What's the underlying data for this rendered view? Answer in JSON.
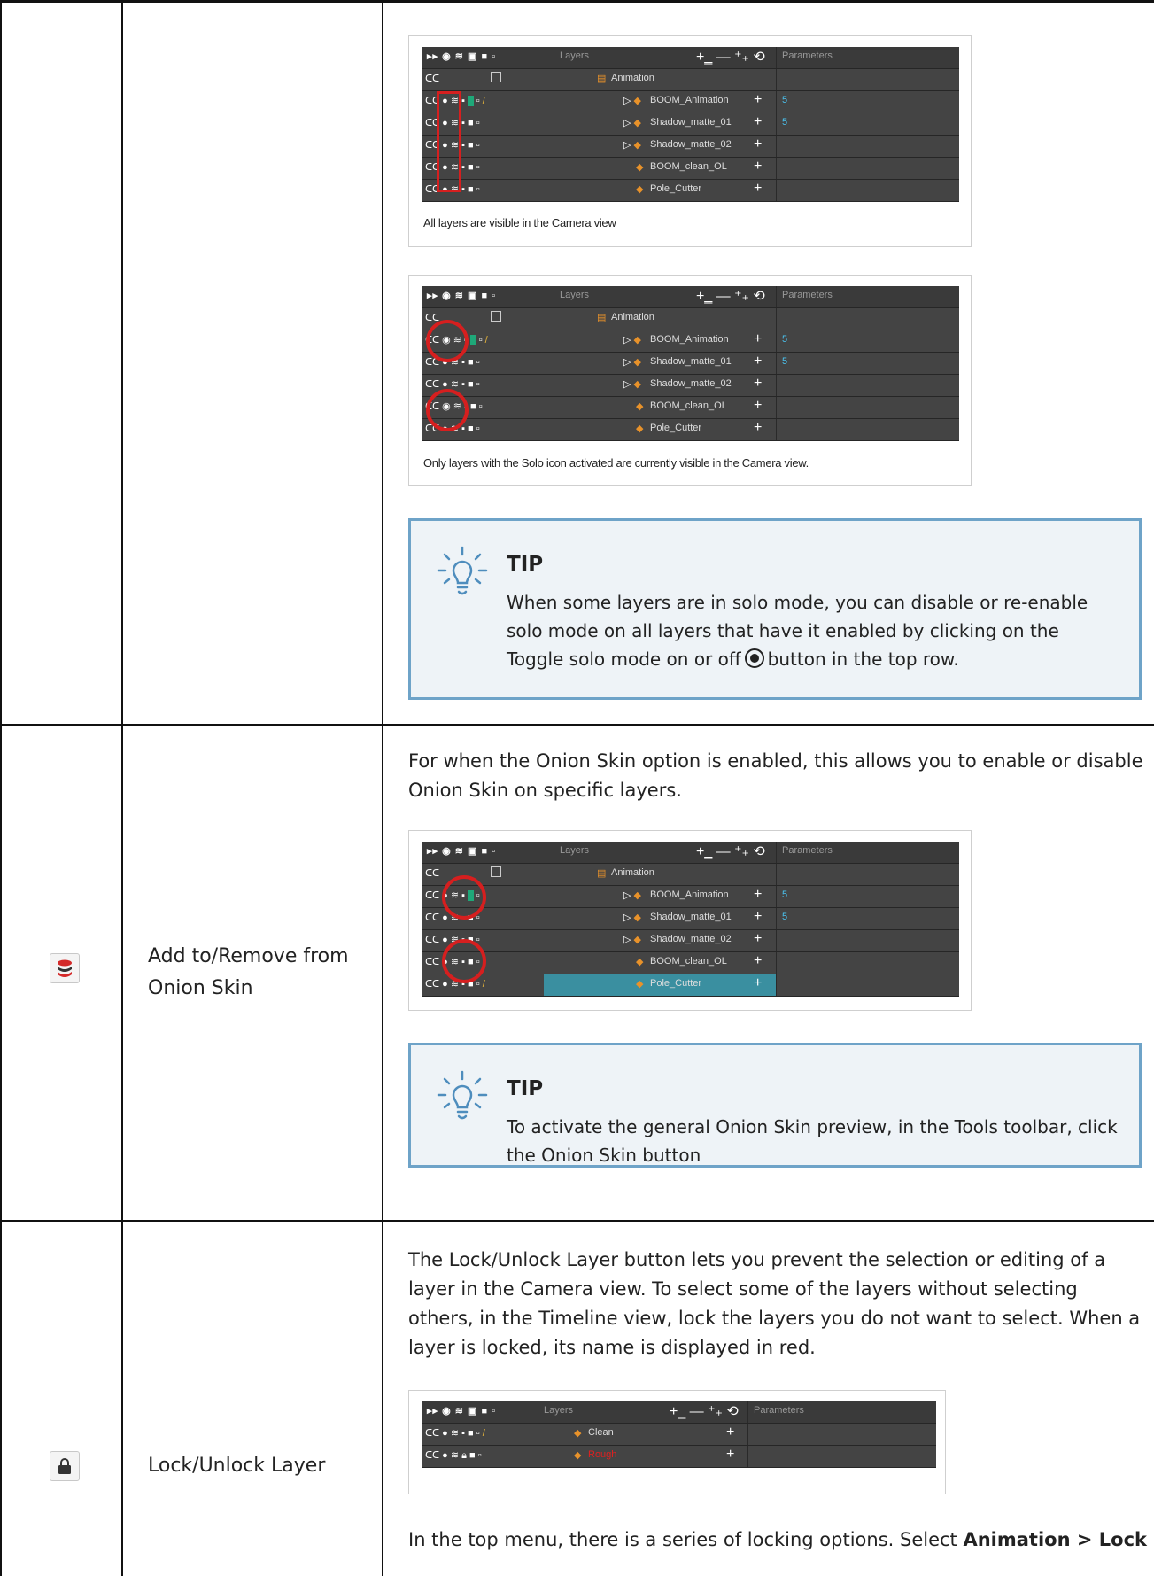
{
  "solo_section": {
    "example1_caption": "All layers are visible in the Camera view",
    "example2_caption": "Only layers with the Solo icon activated are currently visible in the Camera view.",
    "tip": {
      "title": "TIP",
      "body_part1": "When some layers are in solo mode, you can disable or re-enable solo mode on all layers that have it enabled by clicking on the Toggle solo mode on or off",
      "body_part2": "button in the top row."
    }
  },
  "onion_section": {
    "icon": "onion-skin-icon",
    "name": "Add to/Remove from Onion Skin",
    "description": "For when the Onion Skin option is enabled, this allows you to enable or disable Onion Skin on specific layers.",
    "tip": {
      "title": "TIP",
      "body": "To activate the general Onion Skin preview, in the Tools toolbar, click the Onion Skin button"
    }
  },
  "lock_section": {
    "icon": "lock-icon",
    "name": "Lock/Unlock Layer",
    "description": "The Lock/Unlock Layer button lets you prevent the selection or editing of a layer in the Camera view. To select some of the layers without selecting others, in the Timeline view, lock the layers you do not want to select. When a layer is locked, its name is displayed in red.",
    "footer_text_part1": "In the top menu, there is a series of locking options. Select",
    "footer_text_bold": "Animation > Lock"
  },
  "timeline": {
    "header_layers": "Layers",
    "header_parameters": "Parameters",
    "group_layer": "Animation",
    "layers": [
      "BOOM_Animation",
      "Shadow_matte_01",
      "Shadow_matte_02",
      "BOOM_clean_OL",
      "Pole_Cutter"
    ],
    "param_values": [
      "5",
      "5",
      "",
      "",
      ""
    ],
    "lock_layers": [
      "Clean",
      "Rough"
    ]
  },
  "colors": {
    "accent_red": "#d61f1f",
    "tip_border": "#6ea3c8",
    "tip_bg": "#eef3f7",
    "selected_row": "#3a8fa0",
    "green_swatch": "#1fa879"
  }
}
